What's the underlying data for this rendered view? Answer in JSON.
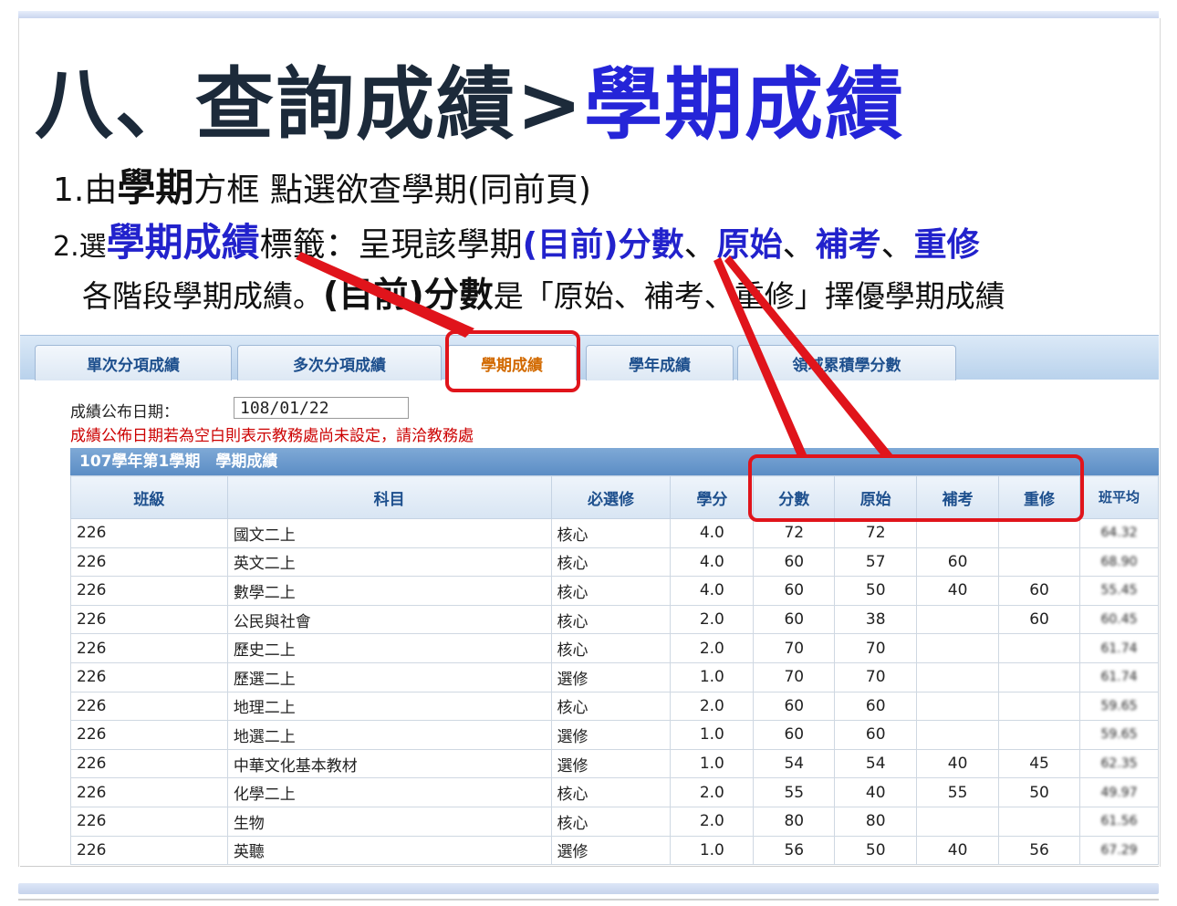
{
  "slide": {
    "title_prefix": "八、查詢成績>",
    "title_highlight": "學期成績",
    "line1": {
      "num": "1.由",
      "bold": "學期",
      "rest": "方框 點選欲查學期(同前頁)"
    },
    "line2": {
      "num": "2.選",
      "blue": "學期成績",
      "mid": "標籤：呈現該學期",
      "b1": "(目前)分數",
      "s1": "、",
      "b2": "原始",
      "s2": "、",
      "b3": "補考",
      "s3": "、",
      "b4": "重修"
    },
    "line3": {
      "a": "各階段學期成績。",
      "bold": "(目前)分數",
      "rest": "是「原始、補考、重修」擇優學期成績"
    }
  },
  "tabs": [
    {
      "label": "單次分項成績",
      "active": false
    },
    {
      "label": "多次分項成績",
      "active": false
    },
    {
      "label": "學期成績",
      "active": true
    },
    {
      "label": "學年成績",
      "active": false
    },
    {
      "label": "領域累積學分數",
      "active": false
    }
  ],
  "publish": {
    "label": "成績公布日期：",
    "value": "108/01/22"
  },
  "warning": "成績公佈日期若為空白則表示教務處尚未設定，請洽教務處",
  "caption": "107學年第1學期　學期成績",
  "table": {
    "headers": [
      "班級",
      "科目",
      "必選修",
      "學分",
      "分數",
      "原始",
      "補考",
      "重修",
      "班平均"
    ],
    "rows": [
      [
        "226",
        "國文二上",
        "核心",
        "4.0",
        "72",
        "72",
        "",
        "",
        "64.32"
      ],
      [
        "226",
        "英文二上",
        "核心",
        "4.0",
        "60",
        "57",
        "60",
        "",
        "68.90"
      ],
      [
        "226",
        "數學二上",
        "核心",
        "4.0",
        "60",
        "50",
        "40",
        "60",
        "55.45"
      ],
      [
        "226",
        "公民與社會",
        "核心",
        "2.0",
        "60",
        "38",
        "",
        "60",
        "60.45"
      ],
      [
        "226",
        "歷史二上",
        "核心",
        "2.0",
        "70",
        "70",
        "",
        "",
        "61.74"
      ],
      [
        "226",
        "歷選二上",
        "選修",
        "1.0",
        "70",
        "70",
        "",
        "",
        "61.74"
      ],
      [
        "226",
        "地理二上",
        "核心",
        "2.0",
        "60",
        "60",
        "",
        "",
        "59.65"
      ],
      [
        "226",
        "地選二上",
        "選修",
        "1.0",
        "60",
        "60",
        "",
        "",
        "59.65"
      ],
      [
        "226",
        "中華文化基本教材",
        "選修",
        "1.0",
        "54",
        "54",
        "40",
        "45",
        "62.35"
      ],
      [
        "226",
        "化學二上",
        "核心",
        "2.0",
        "55",
        "40",
        "55",
        "50",
        "49.97"
      ],
      [
        "226",
        "生物",
        "核心",
        "2.0",
        "80",
        "80",
        "",
        "",
        "61.56"
      ],
      [
        "226",
        "英聽",
        "選修",
        "1.0",
        "56",
        "50",
        "40",
        "56",
        "67.29"
      ]
    ]
  },
  "colors": {
    "highlight": "#2525d8",
    "annotation": "#e0141b",
    "warning": "#cc0000",
    "active_tab": "#d26a00"
  }
}
